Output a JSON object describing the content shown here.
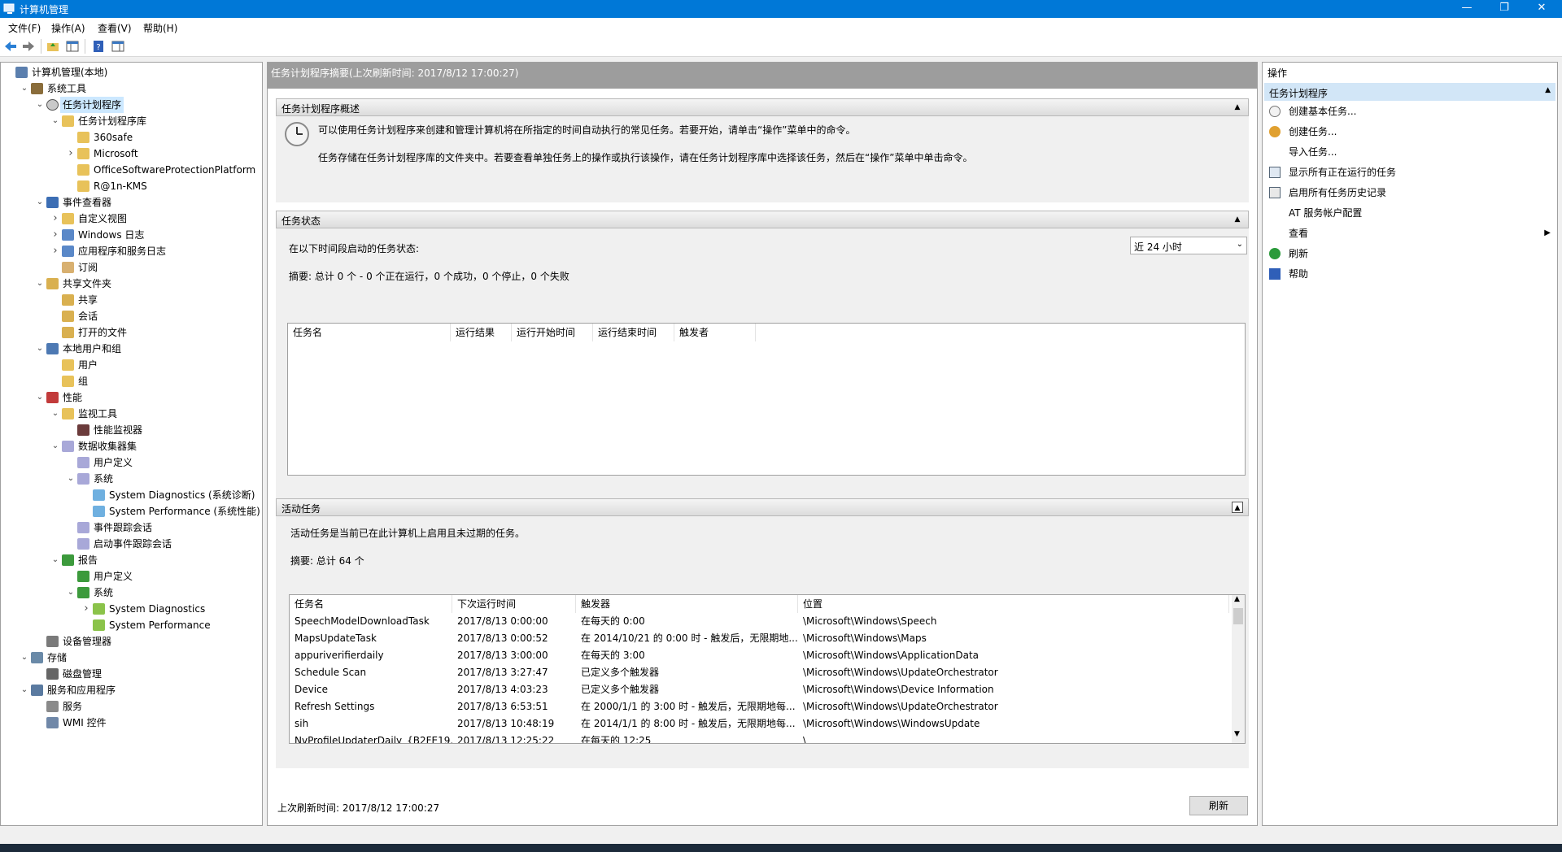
{
  "window": {
    "title": "计算机管理",
    "minimize": "—",
    "maximize": "❐",
    "close": "✕"
  },
  "menu": [
    "文件(F)",
    "操作(A)",
    "查看(V)",
    "帮助(H)"
  ],
  "tree": [
    {
      "label": "计算机管理(本地)",
      "level": 0,
      "toggle": "",
      "icon": "computer-icon"
    },
    {
      "label": "系统工具",
      "level": 1,
      "toggle": "v",
      "icon": "tools-icon"
    },
    {
      "label": "任务计划程序",
      "level": 2,
      "toggle": "v",
      "icon": "clock-icon",
      "selected": true
    },
    {
      "label": "任务计划程序库",
      "level": 3,
      "toggle": "v",
      "icon": "folder-icon"
    },
    {
      "label": "360safe",
      "level": 4,
      "toggle": "",
      "icon": "folder-icon"
    },
    {
      "label": "Microsoft",
      "level": 4,
      "toggle": ">",
      "icon": "folder-icon"
    },
    {
      "label": "OfficeSoftwareProtectionPlatform",
      "level": 4,
      "toggle": "",
      "icon": "folder-icon"
    },
    {
      "label": "R@1n-KMS",
      "level": 4,
      "toggle": "",
      "icon": "folder-icon"
    },
    {
      "label": "事件查看器",
      "level": 2,
      "toggle": "v",
      "icon": "event-viewer-icon"
    },
    {
      "label": "自定义视图",
      "level": 3,
      "toggle": ">",
      "icon": "folder-icon"
    },
    {
      "label": "Windows 日志",
      "level": 3,
      "toggle": ">",
      "icon": "log-icon"
    },
    {
      "label": "应用程序和服务日志",
      "level": 3,
      "toggle": ">",
      "icon": "log-icon"
    },
    {
      "label": "订阅",
      "level": 3,
      "toggle": "",
      "icon": "subscription-icon"
    },
    {
      "label": "共享文件夹",
      "level": 2,
      "toggle": "v",
      "icon": "shared-folder-icon"
    },
    {
      "label": "共享",
      "level": 3,
      "toggle": "",
      "icon": "shared-folder-icon"
    },
    {
      "label": "会话",
      "level": 3,
      "toggle": "",
      "icon": "shared-folder-icon"
    },
    {
      "label": "打开的文件",
      "level": 3,
      "toggle": "",
      "icon": "shared-folder-icon"
    },
    {
      "label": "本地用户和组",
      "level": 2,
      "toggle": "v",
      "icon": "users-icon"
    },
    {
      "label": "用户",
      "level": 3,
      "toggle": "",
      "icon": "folder-icon"
    },
    {
      "label": "组",
      "level": 3,
      "toggle": "",
      "icon": "folder-icon"
    },
    {
      "label": "性能",
      "level": 2,
      "toggle": "v",
      "icon": "performance-icon"
    },
    {
      "label": "监视工具",
      "level": 3,
      "toggle": "v",
      "icon": "folder-icon"
    },
    {
      "label": "性能监视器",
      "level": 4,
      "toggle": "",
      "icon": "monitor-icon"
    },
    {
      "label": "数据收集器集",
      "level": 3,
      "toggle": "v",
      "icon": "collector-icon"
    },
    {
      "label": "用户定义",
      "level": 4,
      "toggle": "",
      "icon": "collector-icon"
    },
    {
      "label": "系统",
      "level": 4,
      "toggle": "v",
      "icon": "collector-icon"
    },
    {
      "label": "System Diagnostics (系统诊断)",
      "level": 5,
      "toggle": "",
      "icon": "diagnostics-icon"
    },
    {
      "label": "System Performance (系统性能)",
      "level": 5,
      "toggle": "",
      "icon": "diagnostics-icon"
    },
    {
      "label": "事件跟踪会话",
      "level": 4,
      "toggle": "",
      "icon": "collector-icon"
    },
    {
      "label": "启动事件跟踪会话",
      "level": 4,
      "toggle": "",
      "icon": "collector-icon"
    },
    {
      "label": "报告",
      "level": 3,
      "toggle": "v",
      "icon": "report-icon"
    },
    {
      "label": "用户定义",
      "level": 4,
      "toggle": "",
      "icon": "report-icon"
    },
    {
      "label": "系统",
      "level": 4,
      "toggle": "v",
      "icon": "report-icon"
    },
    {
      "label": "System Diagnostics",
      "level": 5,
      "toggle": ">",
      "icon": "report-folder-icon"
    },
    {
      "label": "System Performance",
      "level": 5,
      "toggle": "",
      "icon": "report-folder-icon"
    },
    {
      "label": "设备管理器",
      "level": 2,
      "toggle": "",
      "icon": "device-manager-icon"
    },
    {
      "label": "存储",
      "level": 1,
      "toggle": "v",
      "icon": "storage-icon"
    },
    {
      "label": "磁盘管理",
      "level": 2,
      "toggle": "",
      "icon": "disk-icon"
    },
    {
      "label": "服务和应用程序",
      "level": 1,
      "toggle": "v",
      "icon": "services-apps-icon"
    },
    {
      "label": "服务",
      "level": 2,
      "toggle": "",
      "icon": "services-icon"
    },
    {
      "label": "WMI 控件",
      "level": 2,
      "toggle": "",
      "icon": "wmi-icon"
    }
  ],
  "center": {
    "header": "任务计划程序摘要(上次刷新时间: 2017/8/12 17:00:27)",
    "overview": {
      "title": "任务计划程序概述",
      "text1": "可以使用任务计划程序来创建和管理计算机将在所指定的时间自动执行的常见任务。若要开始，请单击“操作”菜单中的命令。",
      "text2": "任务存储在任务计划程序库的文件夹中。若要查看单独任务上的操作或执行该操作，请在任务计划程序库中选择该任务，然后在“操作”菜单中单击命令。"
    },
    "status": {
      "title": "任务状态",
      "period_label": "在以下时间段启动的任务状态:",
      "period_value": "近 24 小时",
      "summary": "摘要: 总计 0 个 - 0 个正在运行，0 个成功，0 个停止，0 个失败",
      "columns": [
        "任务名",
        "运行结果",
        "运行开始时间",
        "运行结束时间",
        "触发者"
      ]
    },
    "active": {
      "title": "活动任务",
      "desc": "活动任务是当前已在此计算机上启用且未过期的任务。",
      "summary": "摘要: 总计 64 个",
      "columns": [
        "任务名",
        "下次运行时间",
        "触发器",
        "位置"
      ],
      "rows": [
        [
          "SpeechModelDownloadTask",
          "2017/8/13 0:00:00",
          "在每天的 0:00",
          "\\Microsoft\\Windows\\Speech"
        ],
        [
          "MapsUpdateTask",
          "2017/8/13 0:00:52",
          "在 2014/10/21 的 0:00 时 - 触发后，无限期地...",
          "\\Microsoft\\Windows\\Maps"
        ],
        [
          "appuriverifierdaily",
          "2017/8/13 3:00:00",
          "在每天的 3:00",
          "\\Microsoft\\Windows\\ApplicationData"
        ],
        [
          "Schedule Scan",
          "2017/8/13 3:27:47",
          "已定义多个触发器",
          "\\Microsoft\\Windows\\UpdateOrchestrator"
        ],
        [
          "Device",
          "2017/8/13 4:03:23",
          "已定义多个触发器",
          "\\Microsoft\\Windows\\Device Information"
        ],
        [
          "Refresh Settings",
          "2017/8/13 6:53:51",
          "在 2000/1/1 的 3:00 时 - 触发后，无限期地每...",
          "\\Microsoft\\Windows\\UpdateOrchestrator"
        ],
        [
          "sih",
          "2017/8/13 10:48:19",
          "在 2014/1/1 的 8:00 时 - 触发后，无限期地每...",
          "\\Microsoft\\Windows\\WindowsUpdate"
        ],
        [
          "NvProfileUpdaterDaily_{B2FE19...",
          "2017/8/13 12:25:22",
          "在每天的 12:25",
          "\\"
        ]
      ]
    },
    "footer_refresh": "上次刷新时间: 2017/8/12 17:00:27",
    "refresh_button": "刷新"
  },
  "actions": {
    "title": "操作",
    "section": "任务计划程序",
    "items": [
      {
        "label": "创建基本任务...",
        "icon": "create-basic-task-icon"
      },
      {
        "label": "创建任务...",
        "icon": "create-task-icon"
      },
      {
        "label": "导入任务...",
        "icon": ""
      },
      {
        "label": "显示所有正在运行的任务",
        "icon": "running-tasks-icon"
      },
      {
        "label": "启用所有任务历史记录",
        "icon": "history-icon"
      },
      {
        "label": "AT 服务帐户配置",
        "icon": ""
      },
      {
        "label": "查看",
        "icon": "",
        "submenu": true
      },
      {
        "label": "刷新",
        "icon": "refresh-icon"
      },
      {
        "label": "帮助",
        "icon": "help-icon"
      }
    ]
  }
}
